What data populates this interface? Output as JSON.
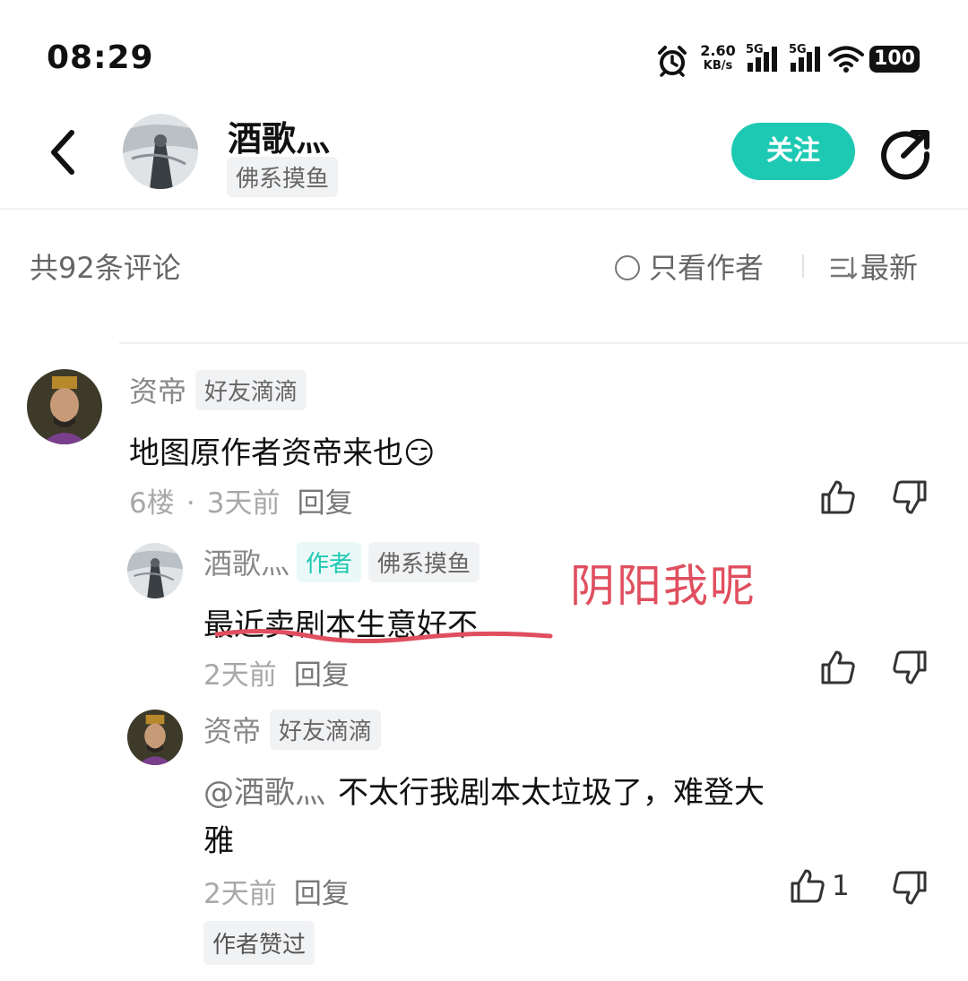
{
  "status_bar": {
    "time": "08:29",
    "net_speed": "2.60",
    "net_unit": "KB/s",
    "sig1_label": "5G",
    "sig2_label": "5G",
    "battery": "100"
  },
  "header": {
    "name": "酒歌灬",
    "tag": "佛系摸鱼",
    "follow_label": "关注"
  },
  "comments_header": {
    "count": "共92条评论",
    "only_author": "只看作者",
    "sort": "最新"
  },
  "annotation": "阴阳我呢",
  "comments": [
    {
      "name": "资帝",
      "tag": "好友滴滴",
      "text": "地图原作者资帝来也",
      "emoji": "😏",
      "floor": "6楼",
      "dot": "·",
      "time": "3天前",
      "reply": "回复"
    },
    {
      "name": "酒歌灬",
      "author_badge": "作者",
      "tag": "佛系摸鱼",
      "text": "最近卖剧本生意好不",
      "time": "2天前",
      "reply": "回复"
    },
    {
      "name": "资帝",
      "tag": "好友滴滴",
      "mention": "@酒歌灬",
      "text_line1": "不太行我剧本太垃圾了，难登大",
      "text_line2": "雅",
      "time": "2天前",
      "reply": "回复",
      "like_count": "1",
      "author_liked": "作者赞过"
    }
  ],
  "colors": {
    "accent": "#1ec9b3",
    "annotation": "#e04f5f"
  }
}
